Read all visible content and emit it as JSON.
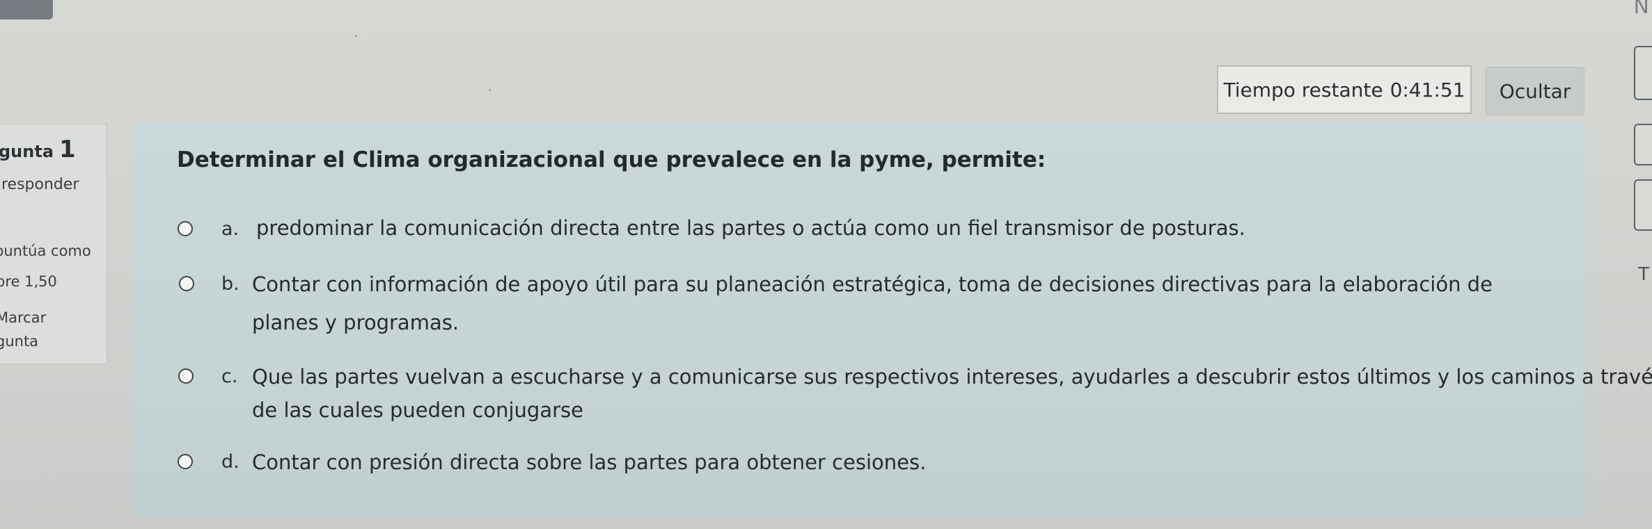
{
  "timer": {
    "label": "Tiempo restante",
    "value": "0:41:51"
  },
  "hide_button": "Ocultar",
  "question_info": {
    "title": "gunta",
    "number": "1",
    "state": "responder",
    "score_line1": "puntúa como",
    "score_line2": "bre 1,50",
    "flag_line1": "Marcar",
    "flag_line2": "gunta"
  },
  "question": {
    "text": "Determinar el Clima organizacional que prevalece en la pyme, permite:",
    "options": [
      {
        "letter": "a.",
        "lines": [
          "predominar la comunicación directa entre las partes o actúa como un fiel transmisor de posturas."
        ]
      },
      {
        "letter": "b.",
        "lines": [
          "Contar con información de apoyo útil para su planeación estratégica, toma de decisiones directivas para la elaboración de",
          "planes y programas."
        ]
      },
      {
        "letter": "c.",
        "lines": [
          "Que las partes vuelvan a escucharse y a comunicarse sus respectivos intereses, ayudarles a descubrir estos últimos y los caminos a través",
          "de las cuales pueden conjugarse"
        ]
      },
      {
        "letter": "d.",
        "lines": [
          "Contar con presión directa sobre las partes para obtener cesiones."
        ]
      }
    ]
  },
  "edge": {
    "corner_glyph": "N",
    "side_glyph": "T"
  }
}
